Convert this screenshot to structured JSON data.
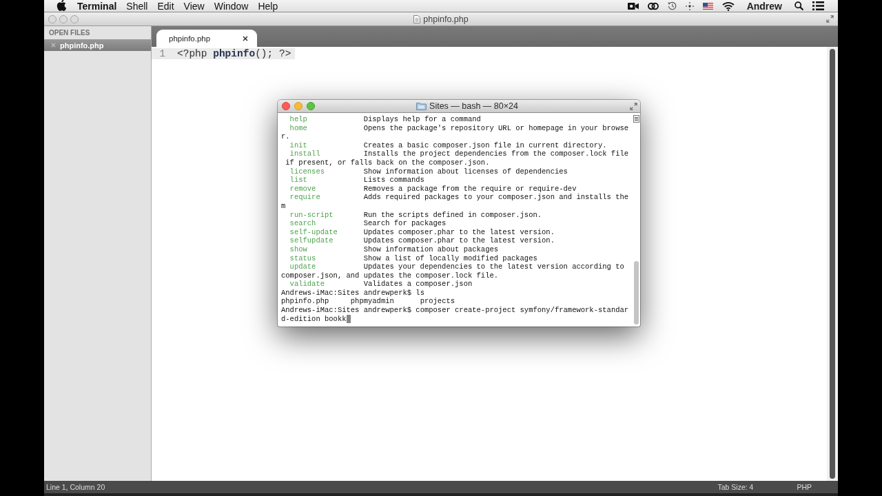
{
  "menu_bar": {
    "app_name": "Terminal",
    "menus": [
      "Shell",
      "Edit",
      "View",
      "Window",
      "Help"
    ],
    "user_name": "Andrew"
  },
  "editor_window": {
    "title": "phpinfo.php",
    "sidebar": {
      "heading": "OPEN FILES",
      "items": [
        {
          "label": "phpinfo.php",
          "selected": true
        }
      ]
    },
    "tabs": [
      {
        "label": "phpinfo.php",
        "selected": true
      }
    ],
    "code_lines": [
      {
        "number": "1",
        "code": "<?php **phpinfo**(); ?>",
        "current": true
      }
    ],
    "status_bar": {
      "position": "Line 1, Column 20",
      "tab_size": "Tab Size: 4",
      "syntax": "PHP"
    }
  },
  "terminal_window": {
    "title": "Sites — bash — 80×24",
    "cursor": true,
    "lines": [
      {
        "kind": "command",
        "command": "help",
        "description": "Displays help for a command"
      },
      {
        "kind": "command",
        "command": "home",
        "description": "Opens the package's repository URL or homepage in your browse"
      },
      {
        "kind": "text",
        "text": "r."
      },
      {
        "kind": "command",
        "command": "init",
        "description": "Creates a basic composer.json file in current directory."
      },
      {
        "kind": "command",
        "command": "install",
        "description": "Installs the project dependencies from the composer.lock file"
      },
      {
        "kind": "text",
        "text": " if present, or falls back on the composer.json."
      },
      {
        "kind": "command",
        "command": "licenses",
        "description": "Show information about licenses of dependencies"
      },
      {
        "kind": "command",
        "command": "list",
        "description": "Lists commands"
      },
      {
        "kind": "command",
        "command": "remove",
        "description": "Removes a package from the require or require-dev"
      },
      {
        "kind": "command",
        "command": "require",
        "description": "Adds required packages to your composer.json and installs the"
      },
      {
        "kind": "text",
        "text": "m"
      },
      {
        "kind": "command",
        "command": "run-script",
        "description": "Run the scripts defined in composer.json."
      },
      {
        "kind": "command",
        "command": "search",
        "description": "Search for packages"
      },
      {
        "kind": "command",
        "command": "self-update",
        "description": "Updates composer.phar to the latest version."
      },
      {
        "kind": "command",
        "command": "selfupdate",
        "description": "Updates composer.phar to the latest version."
      },
      {
        "kind": "command",
        "command": "show",
        "description": "Show information about packages"
      },
      {
        "kind": "command",
        "command": "status",
        "description": "Show a list of locally modified packages"
      },
      {
        "kind": "command",
        "command": "update",
        "description": "Updates your dependencies to the latest version according to"
      },
      {
        "kind": "text",
        "text": "composer.json, and updates the composer.lock file."
      },
      {
        "kind": "command",
        "command": "validate",
        "description": "Validates a composer.json"
      },
      {
        "kind": "text",
        "text": "Andrews-iMac:Sites andrewperk$ ls"
      },
      {
        "kind": "text",
        "text": "phpinfo.php     phpmyadmin      projects"
      },
      {
        "kind": "text",
        "text": "Andrews-iMac:Sites andrewperk$ composer create-project symfony/framework-standar"
      },
      {
        "kind": "text",
        "text": "d-edition bookk"
      }
    ]
  }
}
